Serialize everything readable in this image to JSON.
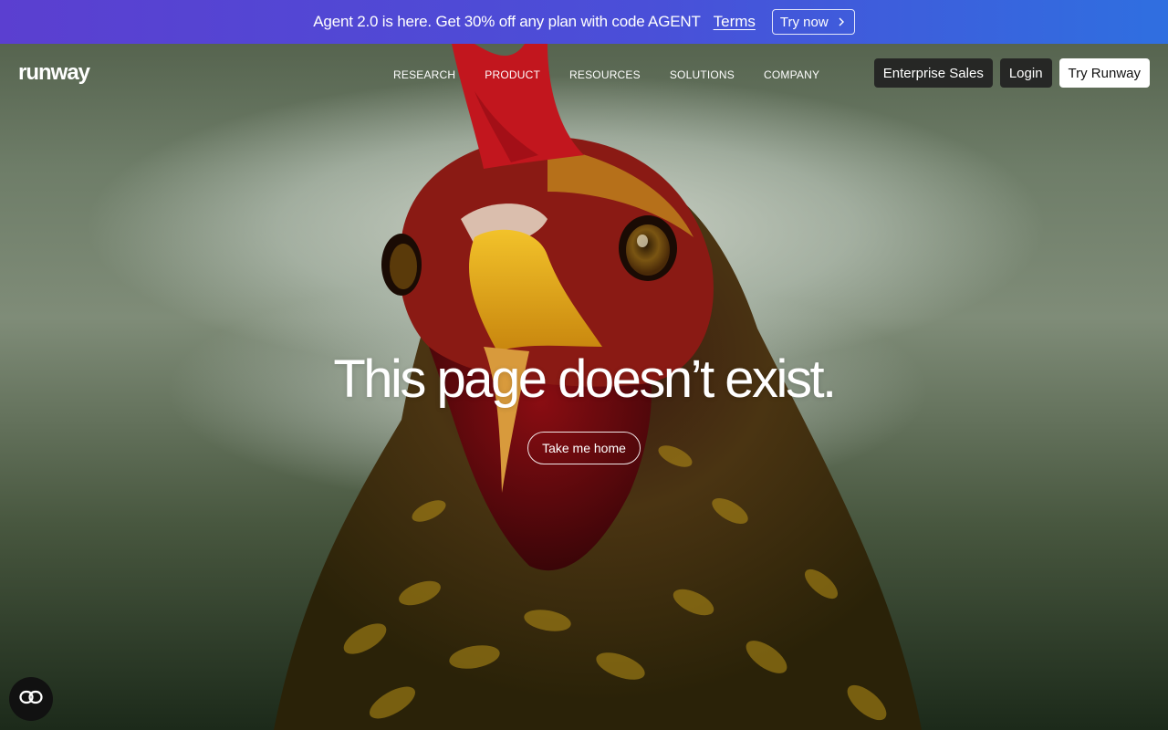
{
  "banner": {
    "text": "Agent 2.0 is here. Get 30% off any plan with code AGENT",
    "terms_label": "Terms",
    "cta_label": "Try now",
    "cta_icon": "chevron-right-icon",
    "gradient_colors": [
      "#5b3fd0",
      "#4a4fd8",
      "#2f6fe0"
    ]
  },
  "nav": {
    "logo": "runway",
    "links": [
      {
        "label": "RESEARCH"
      },
      {
        "label": "PRODUCT"
      },
      {
        "label": "RESOURCES"
      },
      {
        "label": "SOLUTIONS"
      },
      {
        "label": "COMPANY"
      }
    ],
    "actions": {
      "enterprise_label": "Enterprise Sales",
      "login_label": "Login",
      "try_label": "Try Runway"
    }
  },
  "main": {
    "headline": "This page doesn’t exist.",
    "home_button_label": "Take me home"
  },
  "floating_button": {
    "icon": "link-icon"
  },
  "colors": {
    "button_dark": "#222222",
    "button_light": "#ffffff",
    "text": "#ffffff"
  }
}
